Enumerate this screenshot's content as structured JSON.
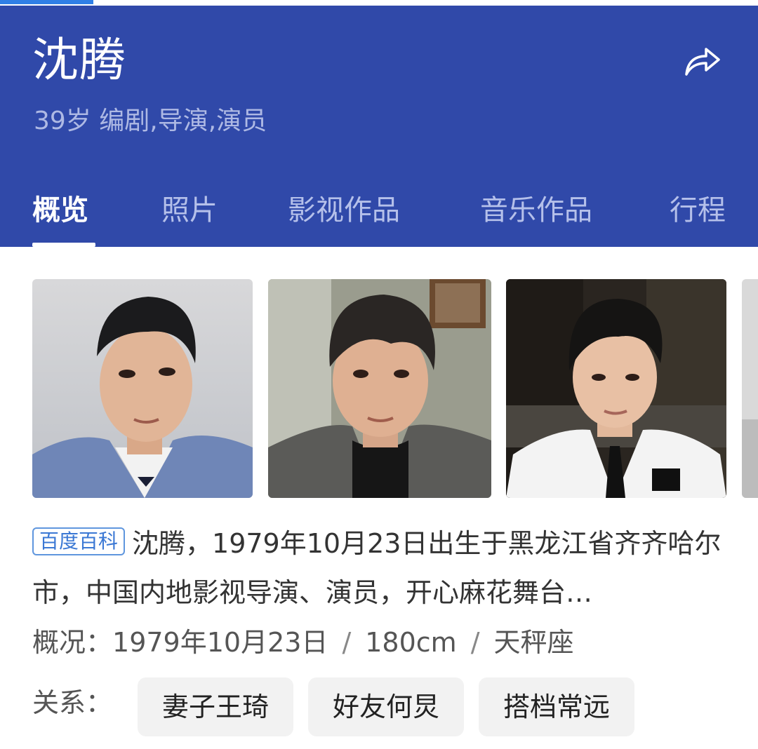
{
  "header": {
    "name": "沈腾",
    "subtitle": "39岁 编剧,导演,演员",
    "share_icon": "share-icon"
  },
  "tabs": [
    {
      "label": "概览",
      "active": true
    },
    {
      "label": "照片",
      "active": false
    },
    {
      "label": "影视作品",
      "active": false
    },
    {
      "label": "音乐作品",
      "active": false
    },
    {
      "label": "行程",
      "active": false
    }
  ],
  "photos": [
    {
      "label": "photo-1"
    },
    {
      "label": "photo-2"
    },
    {
      "label": "photo-3"
    }
  ],
  "summary": {
    "source_badge": "百度百科",
    "text": "沈腾，1979年10月23日出生于黑龙江省齐齐哈尔市，中国内地影视导演、演员，开心麻花舞台…"
  },
  "overview": {
    "label": "概况：",
    "birthday": "1979年10月23日",
    "height": "180cm",
    "zodiac": "天秤座",
    "separator": "/"
  },
  "relations": {
    "label": "关系：",
    "items": [
      "妻子王琦",
      "好友何炅",
      "搭档常远"
    ]
  },
  "colors": {
    "header_bg": "#3049a9",
    "badge": "#3b78d4"
  }
}
